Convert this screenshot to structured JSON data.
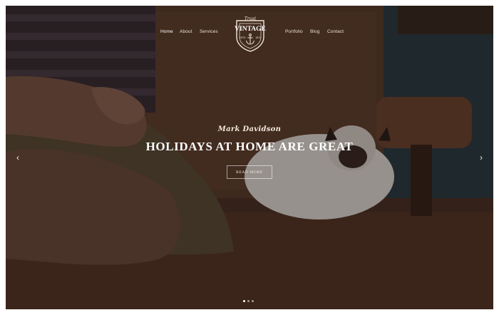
{
  "nav": {
    "left": [
      {
        "label": "Home",
        "active": true
      },
      {
        "label": "About",
        "active": false
      },
      {
        "label": "Services",
        "active": false
      }
    ],
    "right": [
      {
        "label": "Portfolio",
        "active": false
      },
      {
        "label": "Blog",
        "active": false
      },
      {
        "label": "Contact",
        "active": false
      }
    ]
  },
  "logo": {
    "top_text": "Trust",
    "main_text": "VINTAGE",
    "est_left": "ESTD",
    "est_year": "1871",
    "icon": "anchor-icon"
  },
  "hero": {
    "subtitle": "Mark Davidson",
    "title": "HOLIDAYS AT HOME ARE GREAT",
    "button_label": "READ MORE",
    "prev_icon": "chevron-left-icon",
    "next_icon": "chevron-right-icon",
    "prev_glyph": "‹",
    "next_glyph": "›",
    "slides": [
      {
        "active": true
      },
      {
        "active": false
      },
      {
        "active": false
      }
    ]
  },
  "colors": {
    "overlay": "#1f1410",
    "text": "#ffffff"
  }
}
